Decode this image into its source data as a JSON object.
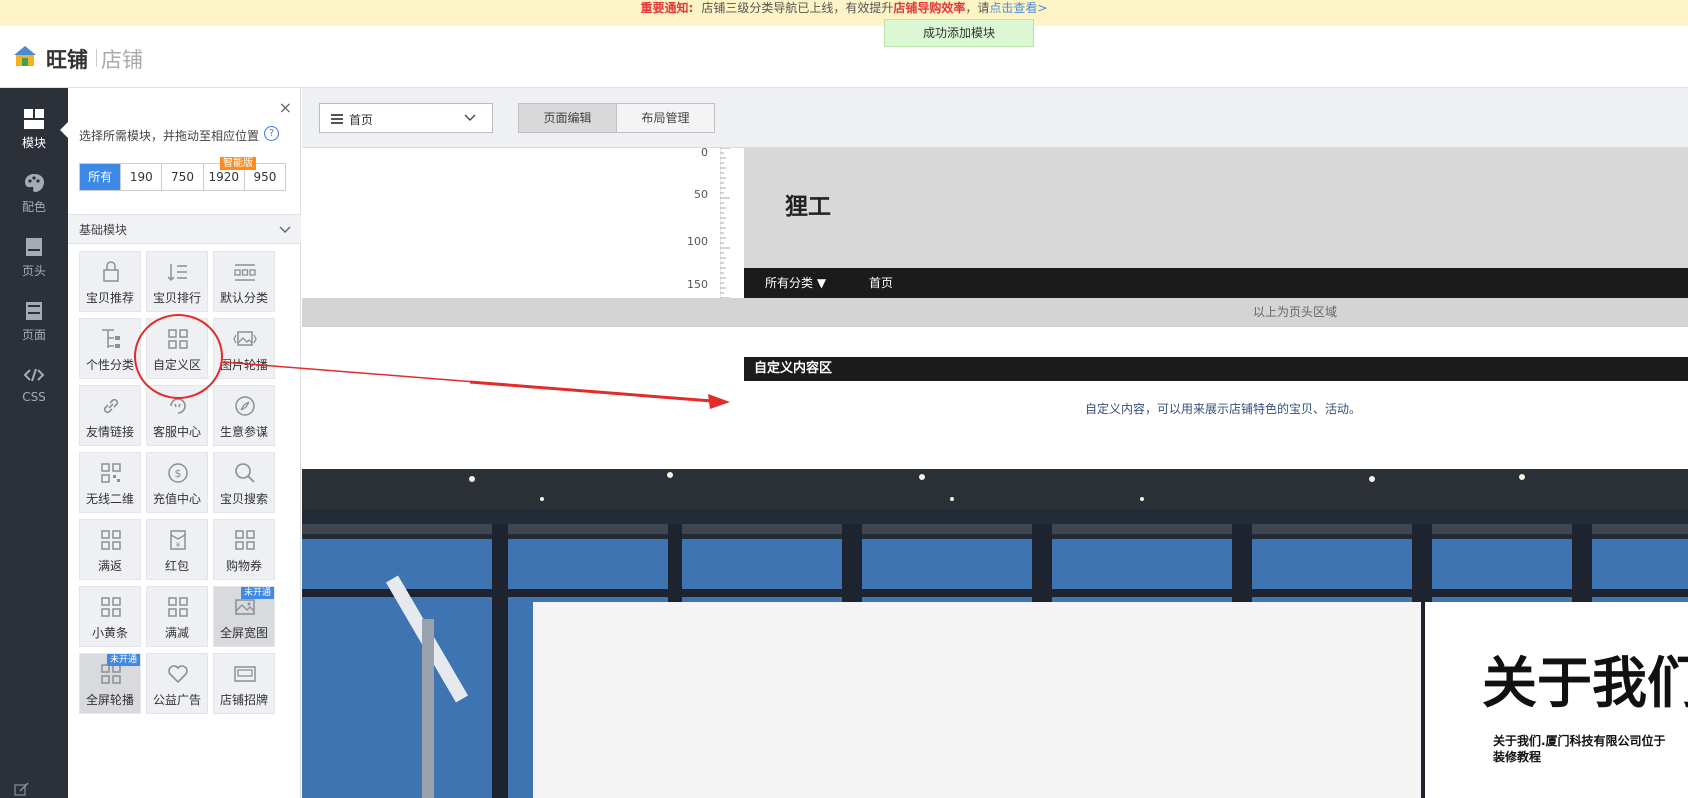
{
  "notice": {
    "label": "重要通知:",
    "text_before": "店铺三级分类导航已上线，有效提升",
    "strong": "店铺导购效率",
    "text_after": "，请",
    "link": "点击查看>"
  },
  "toast": "成功添加模块",
  "brand": {
    "name": "旺铺",
    "sub": "店铺"
  },
  "leftnav": {
    "items": [
      {
        "label": "模块",
        "icon": "grid-icon"
      },
      {
        "label": "配色",
        "icon": "palette-icon"
      },
      {
        "label": "页头",
        "icon": "header-icon"
      },
      {
        "label": "页面",
        "icon": "page-icon"
      },
      {
        "label": "CSS",
        "icon": "code-icon"
      }
    ]
  },
  "panel": {
    "close": "×",
    "hint": "选择所需模块，并拖动至相应位置",
    "help": "?",
    "size_tabs": [
      "所有",
      "190",
      "750",
      "1920",
      "950"
    ],
    "smart_badge": "智能版",
    "section_title": "基础模块",
    "modules": [
      {
        "label": "宝贝推荐",
        "icon": "bag-icon"
      },
      {
        "label": "宝贝排行",
        "icon": "rank-list-icon"
      },
      {
        "label": "默认分类",
        "icon": "category-icon"
      },
      {
        "label": "个性分类",
        "icon": "tree-icon"
      },
      {
        "label": "自定义区",
        "icon": "custom-grid-icon"
      },
      {
        "label": "图片轮播",
        "icon": "image-carousel-icon"
      },
      {
        "label": "友情链接",
        "icon": "link-icon"
      },
      {
        "label": "客服中心",
        "icon": "service-icon"
      },
      {
        "label": "生意参谋",
        "icon": "compass-icon"
      },
      {
        "label": "无线二维",
        "icon": "qrcode-icon"
      },
      {
        "label": "充值中心",
        "icon": "dollar-icon"
      },
      {
        "label": "宝贝搜索",
        "icon": "search-icon"
      },
      {
        "label": "满返",
        "icon": "grid-icon"
      },
      {
        "label": "红包",
        "icon": "red-envelope-icon"
      },
      {
        "label": "购物券",
        "icon": "grid-icon"
      },
      {
        "label": "小黄条",
        "icon": "grid-icon"
      },
      {
        "label": "满减",
        "icon": "grid-icon"
      },
      {
        "label": "全屏宽图",
        "icon": "wide-image-icon",
        "badge": "未开通"
      },
      {
        "label": "全屏轮播",
        "icon": "grid-icon",
        "badge": "未开通"
      },
      {
        "label": "公益广告",
        "icon": "heart-icon"
      },
      {
        "label": "店铺招牌",
        "icon": "signboard-icon"
      }
    ]
  },
  "toolbar": {
    "page_select": "首页",
    "mode_tabs": [
      "页面编辑",
      "布局管理"
    ]
  },
  "canvas": {
    "ruler": [
      "0",
      "50",
      "100",
      "150"
    ],
    "store_name": "狸工",
    "nav": [
      "所有分类 ▼",
      "首页"
    ],
    "header_note": "以上为页头区域",
    "custom_title": "自定义内容区",
    "custom_desc": "自定义内容，可以用来展示店铺特色的宝贝、活动。",
    "about_title": "关于我们",
    "about_text": "关于我们.厦门科技有限公司位于",
    "about_text2": "装修教程"
  },
  "colors": {
    "accent": "#3d89e3",
    "nav_dark": "#2c3039",
    "notice_bg": "#fdf4c6",
    "alert_red": "#e4393c",
    "annotation_red": "#e52a2a"
  }
}
